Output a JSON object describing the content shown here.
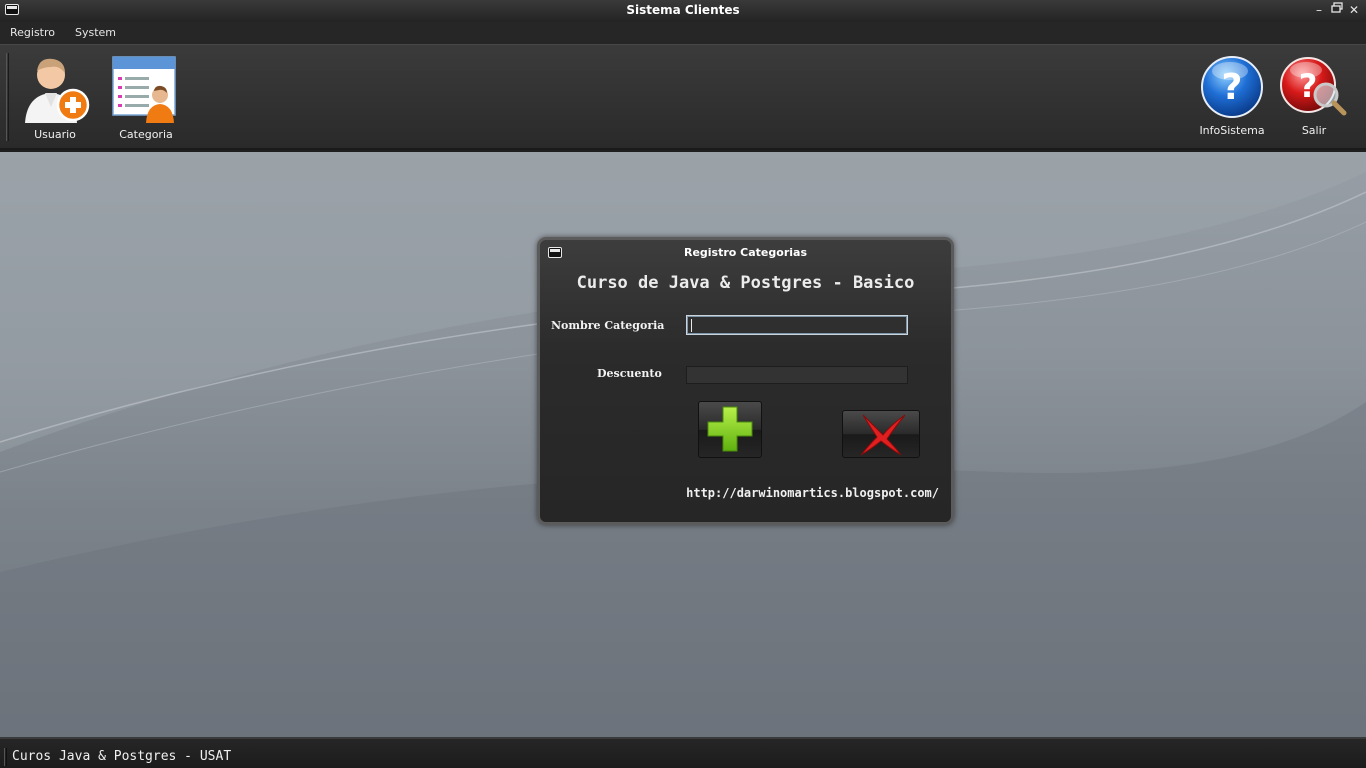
{
  "window": {
    "title": "Sistema Clientes"
  },
  "menu": {
    "items": [
      "Registro",
      "System"
    ]
  },
  "toolbar": {
    "left": [
      {
        "label": "Usuario",
        "icon": "add-user-icon"
      },
      {
        "label": "Categoria",
        "icon": "category-list-icon"
      }
    ],
    "right": [
      {
        "label": "InfoSistema",
        "icon": "help-icon"
      },
      {
        "label": "Salir",
        "icon": "help-search-icon"
      }
    ]
  },
  "dialog": {
    "title": "Registro Categorias",
    "heading": "Curso de Java & Postgres - Basico",
    "fields": {
      "nombre": {
        "label": "Nombre Categoria",
        "value": ""
      },
      "descuento": {
        "label": "Descuento",
        "value": ""
      }
    },
    "buttons": {
      "add": "add-icon",
      "cancel": "cancel-icon"
    },
    "url": "http://darwinomartics.blogspot.com/"
  },
  "status": {
    "text": "Curos Java & Postgres - USAT"
  },
  "colors": {
    "chrome": "#2a2a2a",
    "desktop": "#8c939b",
    "add": "#7ecb1f",
    "cancel": "#d81a1a",
    "help": "#1f6fd6"
  }
}
